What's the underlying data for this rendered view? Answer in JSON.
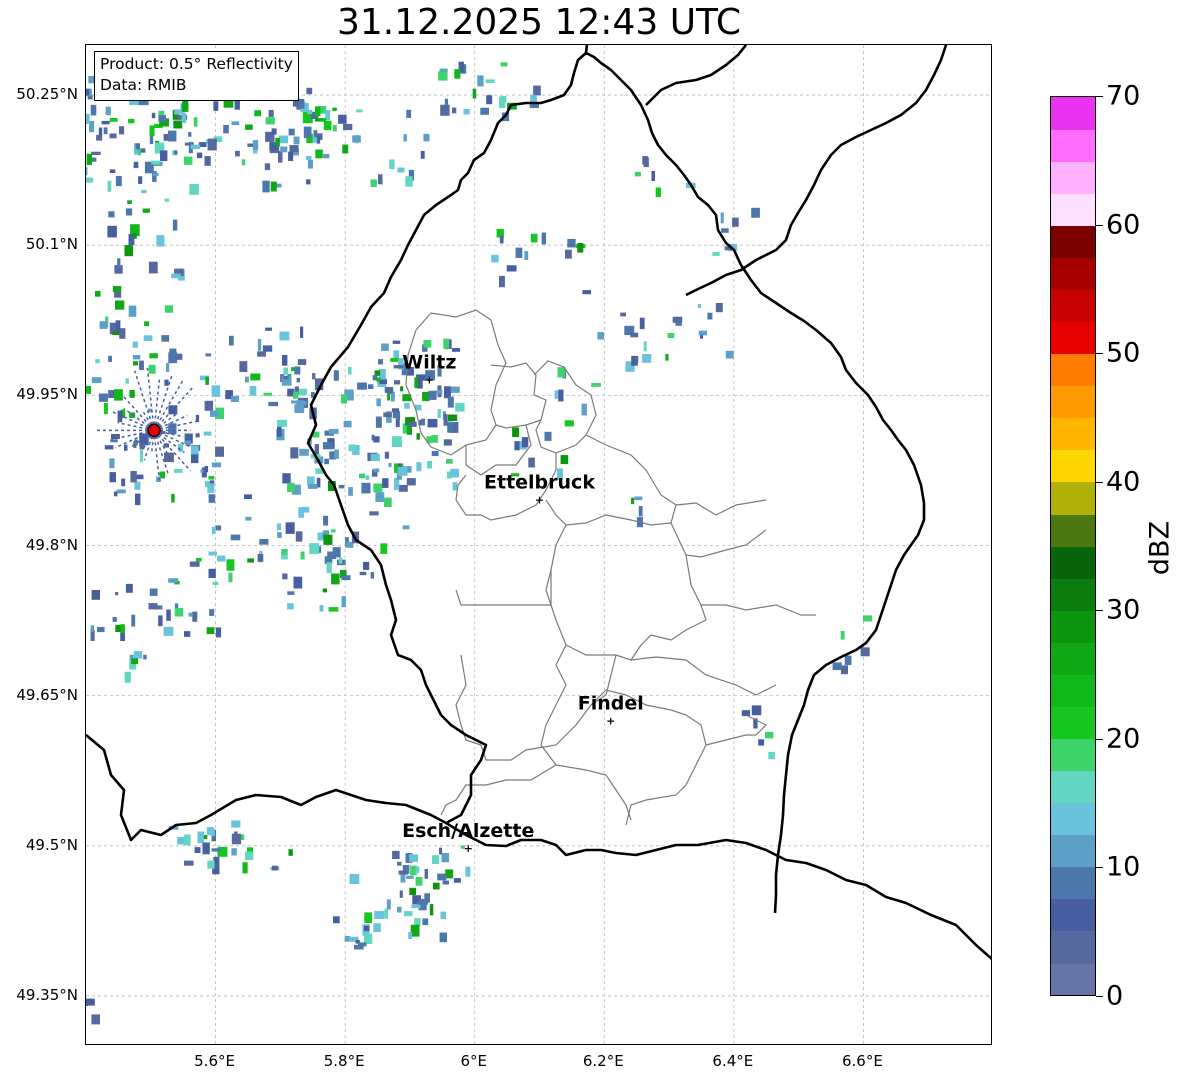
{
  "title": "31.12.2025 12:43 UTC",
  "info_box": {
    "product": "Product: 0.5° Reflectivity",
    "data": "Data: RMIB"
  },
  "map": {
    "lon_range": [
      5.4,
      6.8
    ],
    "lat_range": [
      49.3,
      50.3
    ],
    "lat_ticks": [
      {
        "value": 50.25,
        "label": "50.25°N"
      },
      {
        "value": 50.1,
        "label": "50.1°N"
      },
      {
        "value": 49.95,
        "label": "49.95°N"
      },
      {
        "value": 49.8,
        "label": "49.8°N"
      },
      {
        "value": 49.65,
        "label": "49.65°N"
      },
      {
        "value": 49.5,
        "label": "49.5°N"
      },
      {
        "value": 49.35,
        "label": "49.35°N"
      }
    ],
    "lon_ticks": [
      {
        "value": 5.6,
        "label": "5.6°E"
      },
      {
        "value": 5.8,
        "label": "5.8°E"
      },
      {
        "value": 6.0,
        "label": "6°E"
      },
      {
        "value": 6.2,
        "label": "6.2°E"
      },
      {
        "value": 6.4,
        "label": "6.4°E"
      },
      {
        "value": 6.6,
        "label": "6.6°E"
      }
    ],
    "cities": [
      {
        "name": "Wiltz",
        "lon": 5.93,
        "lat": 49.967
      },
      {
        "name": "Ettelbruck",
        "lon": 6.1,
        "lat": 49.847
      },
      {
        "name": "Findel",
        "lon": 6.21,
        "lat": 49.626
      },
      {
        "name": "Esch/Alzette",
        "lon": 5.99,
        "lat": 49.499
      }
    ],
    "radar_site": {
      "lon": 5.505,
      "lat": 49.915
    }
  },
  "colorbar": {
    "label": "dBZ",
    "min": 0,
    "max": 70,
    "ticks": [
      "0",
      "10",
      "20",
      "30",
      "40",
      "50",
      "60",
      "70"
    ],
    "colors": [
      "#6674a6",
      "#56699e",
      "#475ea0",
      "#4c77ad",
      "#5d9fc6",
      "#69c3da",
      "#62d6c1",
      "#3ed26b",
      "#15c520",
      "#11b81a",
      "#10a715",
      "#0d9510",
      "#0b7d0e",
      "#0a640b",
      "#4b7811",
      "#b0b20a",
      "#ffd700",
      "#ffb400",
      "#ff9a00",
      "#ff7c00",
      "#e60000",
      "#c80000",
      "#a60000",
      "#7a0000",
      "#ffdfff",
      "#ffb0ff",
      "#ff6cff",
      "#ea33ee"
    ]
  }
}
